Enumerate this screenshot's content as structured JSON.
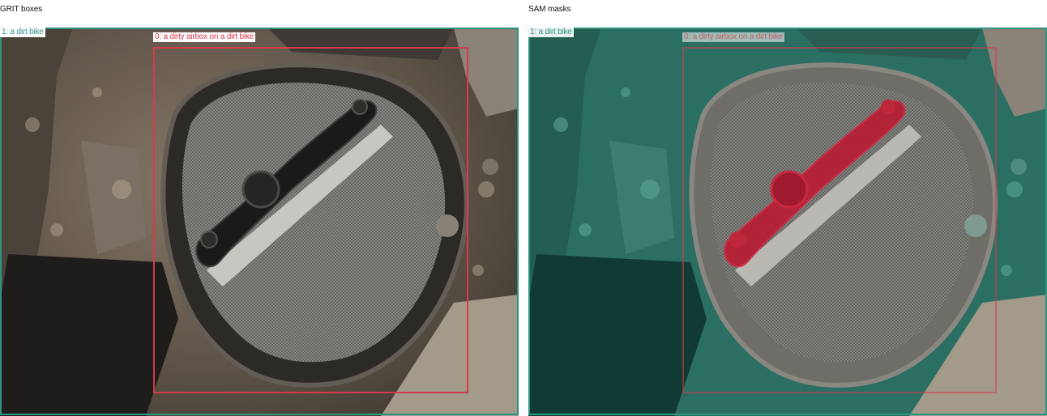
{
  "panels": {
    "left": {
      "title": "GRIT boxes",
      "boxes": [
        {
          "label": "1: a dirt bike",
          "color": "#2e9480"
        },
        {
          "label": "0: a dirty airbox on a dirt bike",
          "color": "#d63a4c"
        }
      ]
    },
    "right": {
      "title": "SAM masks",
      "boxes": [
        {
          "label": "1: a dirt bike",
          "color": "#2e9480"
        },
        {
          "label": "0: a dirty airbox on a dirt bike",
          "color": "#d63a4c"
        }
      ],
      "mask_colors": {
        "bike": "#1f8a7a",
        "airbox": "#c41e3a"
      }
    }
  }
}
